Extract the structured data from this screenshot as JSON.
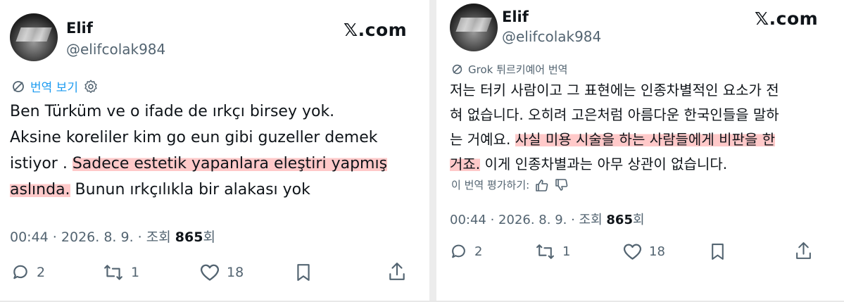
{
  "left": {
    "author": {
      "name": "Elif",
      "handle": "@elifcolak984"
    },
    "brand": "𝕏.com",
    "translate_link": "번역 보기",
    "body": {
      "line1": "Ben Türküm ve o ifade de ırkçı birsey yok.",
      "line2": "Aksine koreliler kim go eun gibi guzeller demek",
      "line3a": "istiyor . ",
      "line3b": "Sadece estetik yapanlara eleştiri yapmış",
      "line4a": "aslında.",
      "line4b": " Bunun ırkçılıkla bir alakası yok"
    },
    "meta": {
      "time": "00:44",
      "date": "2026. 8. 9.",
      "views_label": "조회",
      "views": "865",
      "views_suffix": "회"
    },
    "actions": {
      "replies": "2",
      "reposts": "1",
      "likes": "18"
    }
  },
  "right": {
    "author": {
      "name": "Elif",
      "handle": "@elifcolak984"
    },
    "brand": "𝕏.com",
    "translation_label": "Grok 튀르키예어 번역",
    "body": {
      "line1": "저는 터키 사람이고 그 표현에는 인종차별적인 요소가 전",
      "line2": "혀 없습니다. 오히려 고은처럼 아름다운 한국인들을 말하",
      "line3a": "는 거예요. ",
      "line3b": "사실 미용 시술을 하는 사람들에게 비판을 한",
      "line4a": "거죠.",
      "line4b": " 이게 인종차별과는 아무 상관이 없습니다."
    },
    "rate_label": "이 번역 평가하기:",
    "meta": {
      "time": "00:44",
      "date": "2026. 8. 9.",
      "views_label": "조회",
      "views": "865",
      "views_suffix": "회"
    },
    "actions": {
      "replies": "2",
      "reposts": "1",
      "likes": "18"
    }
  },
  "colors": {
    "link": "#1d9bf0",
    "muted": "#536471",
    "highlight": "#ffb7b7"
  }
}
